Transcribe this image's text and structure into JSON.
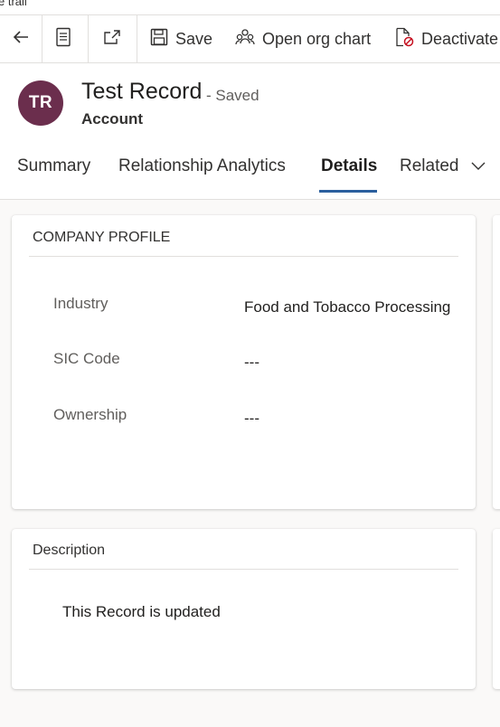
{
  "top_cut_text": "e trail",
  "toolbar": {
    "back_icon": "back-arrow-icon",
    "form_icon": "form-icon",
    "popout_icon": "popout-icon",
    "save_label": "Save",
    "org_chart_label": "Open org chart",
    "deactivate_label": "Deactivate"
  },
  "header": {
    "avatar_initials": "TR",
    "avatar_color": "#6b2e4d",
    "title": "Test Record",
    "status": "- Saved",
    "entity": "Account"
  },
  "tabs": [
    {
      "label": "Summary"
    },
    {
      "label": "Relationship Analytics"
    },
    {
      "label": "Details"
    },
    {
      "label": "Related"
    }
  ],
  "company_profile": {
    "title": "COMPANY PROFILE",
    "fields": [
      {
        "label": "Industry",
        "value": "Food and Tobacco Processing"
      },
      {
        "label": "SIC Code",
        "value": "---"
      },
      {
        "label": "Ownership",
        "value": "---"
      }
    ]
  },
  "description": {
    "title": "Description",
    "text": "This Record is updated"
  },
  "colors": {
    "accent": "#2b5f9e",
    "page_bg": "#faf9f8"
  }
}
